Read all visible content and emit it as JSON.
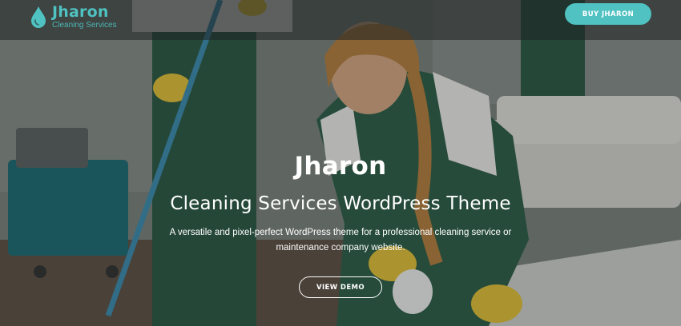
{
  "header": {
    "logo_name": "Jharon",
    "logo_tagline": "Cleaning Services",
    "buy_button_label": "BUY JHARON"
  },
  "hero": {
    "title": "Jharon",
    "subtitle": "Cleaning Services WordPress Theme",
    "description_line1": "A versatile and pixel-perfect WordPress theme for a professional cleaning service or",
    "description_line2": "maintenance company website.",
    "demo_button_label": "VIEW DEMO"
  },
  "colors": {
    "accent": "#4fc2c1",
    "text_light": "#ffffff",
    "overlay": "#1e2222"
  },
  "icons": {
    "logo": "water-drop-icon"
  }
}
